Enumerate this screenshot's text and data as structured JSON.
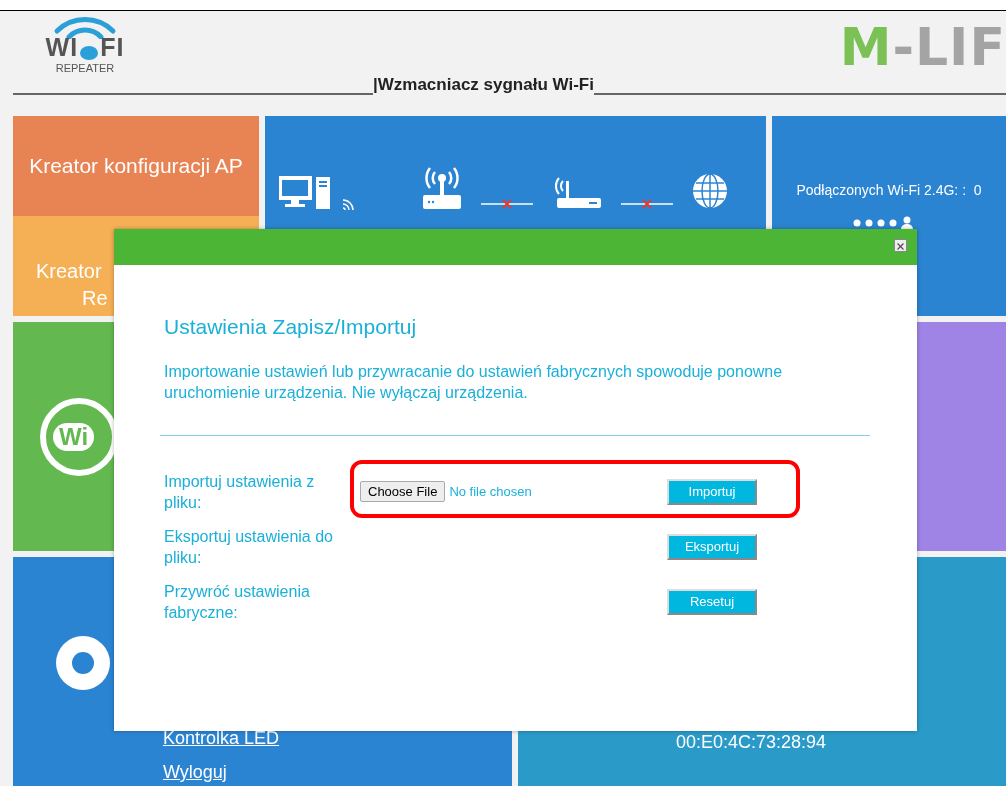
{
  "header": {
    "wifi_logo": {
      "left": "WI",
      "right": "FI",
      "subtitle": "REPEATER"
    },
    "title": "|Wzmacniacz sygnału Wi-Fi",
    "brand": {
      "first": "M",
      "rest": "-LIF"
    }
  },
  "tiles": {
    "wizard_ap": "Kreator konfiguracji AP",
    "wizard_repeater": [
      "Kreator",
      "Re"
    ],
    "wifi_badge": "Wi",
    "connected": "Podłączonych Wi-Fi 2.4G: :  0",
    "links": [
      "Kontrolka LED",
      "Wyloguj"
    ],
    "mac": "00:E0:4C:73:28:94"
  },
  "modal": {
    "title": "Ustawienia Zapisz/Importuj",
    "message": "Importowanie ustawień lub przywracanie do ustawień fabrycznych spowoduje ponowne uruchomienie urządzenia. Nie wyłączaj urządzenia.",
    "rows": [
      {
        "kind": "file",
        "label": "Importuj ustawienia z pliku:",
        "file_button": "Choose File",
        "file_status": "No file chosen",
        "button": "Importuj",
        "highlighted": true
      },
      {
        "kind": "action",
        "label": "Eksportuj ustawienia do pliku:",
        "button": "Eksportuj",
        "highlighted": false
      },
      {
        "kind": "action",
        "label": "Przywróć ustawienia fabryczne:",
        "button": "Resetuj",
        "highlighted": false
      }
    ]
  }
}
